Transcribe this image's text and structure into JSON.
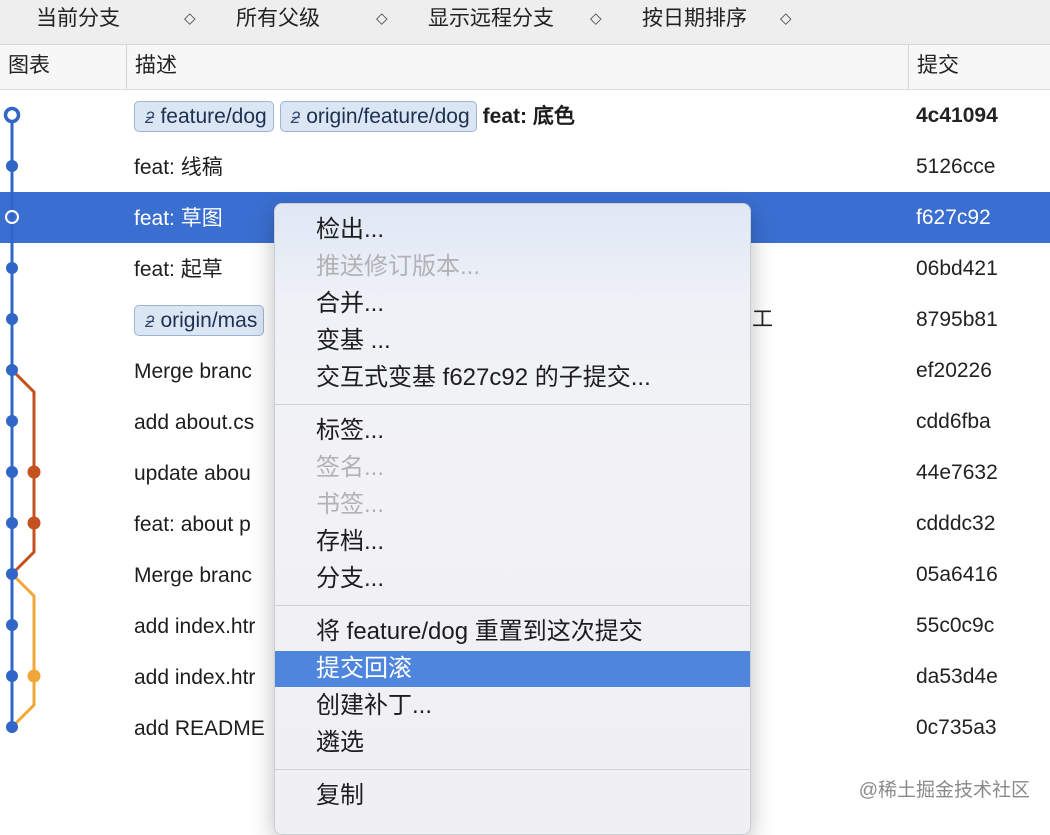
{
  "filter_bar": {
    "items": [
      {
        "label": "当前分支",
        "chevron": "◇"
      },
      {
        "label": "所有父级",
        "chevron": "◇"
      },
      {
        "label": "显示远程分支",
        "chevron": "◇"
      },
      {
        "label": "按日期排序",
        "chevron": "◇"
      }
    ]
  },
  "columns": {
    "graph": "图表",
    "description": "描述",
    "commit": "提交"
  },
  "branch_icon": "branch-icon",
  "commits": [
    {
      "tags": [
        "feature/dog",
        "origin/feature/dog"
      ],
      "message": "feat: 底色",
      "hash": "4c41094",
      "bold": true
    },
    {
      "tags": [],
      "message": "feat: 线稿",
      "hash": "5126cce"
    },
    {
      "tags": [],
      "message": "feat: 草图",
      "hash": "f627c92",
      "selected": true
    },
    {
      "tags": [],
      "message": "feat: 起草",
      "hash": "06bd421"
    },
    {
      "tags": [
        "origin/mas"
      ],
      "message": "",
      "hash": "8795b81"
    },
    {
      "tags": [],
      "message": "Merge branc",
      "hash": "ef20226"
    },
    {
      "tags": [],
      "message": "add about.cs",
      "hash": "cdd6fba"
    },
    {
      "tags": [],
      "message": "update abou",
      "hash": "44e7632"
    },
    {
      "tags": [],
      "message": "feat: about p",
      "hash": "cdddc32"
    },
    {
      "tags": [],
      "message": "Merge branc",
      "hash": "05a6416"
    },
    {
      "tags": [],
      "message": "add index.htr",
      "hash": "55c0c9c"
    },
    {
      "tags": [],
      "message": "add index.htr",
      "hash": "da53d4e"
    },
    {
      "tags": [],
      "message": "add README",
      "hash": "0c735a3"
    }
  ],
  "obscured_fragment": "工",
  "graph_colors": {
    "main": "#2f66c7",
    "branch_orange": "#c4511f",
    "branch_yellow": "#f0a738"
  },
  "context_menu": {
    "groups": [
      [
        {
          "label": "检出...",
          "enabled": true
        },
        {
          "label": "推送修订版本...",
          "enabled": false
        },
        {
          "label": "合并...",
          "enabled": true
        },
        {
          "label": "变基 ...",
          "enabled": true
        },
        {
          "label": "交互式变基 f627c92 的子提交...",
          "enabled": true
        }
      ],
      [
        {
          "label": "标签...",
          "enabled": true
        },
        {
          "label": "签名...",
          "enabled": false
        },
        {
          "label": "书签...",
          "enabled": false
        },
        {
          "label": "存档...",
          "enabled": true
        },
        {
          "label": "分支...",
          "enabled": true
        }
      ],
      [
        {
          "label": "将 feature/dog 重置到这次提交",
          "enabled": true
        },
        {
          "label": "提交回滚",
          "enabled": true,
          "highlighted": true
        },
        {
          "label": "创建补丁...",
          "enabled": true
        },
        {
          "label": "遴选",
          "enabled": true
        }
      ],
      [
        {
          "label": "复制",
          "enabled": true
        }
      ]
    ]
  },
  "watermark": "@稀土掘金技术社区"
}
